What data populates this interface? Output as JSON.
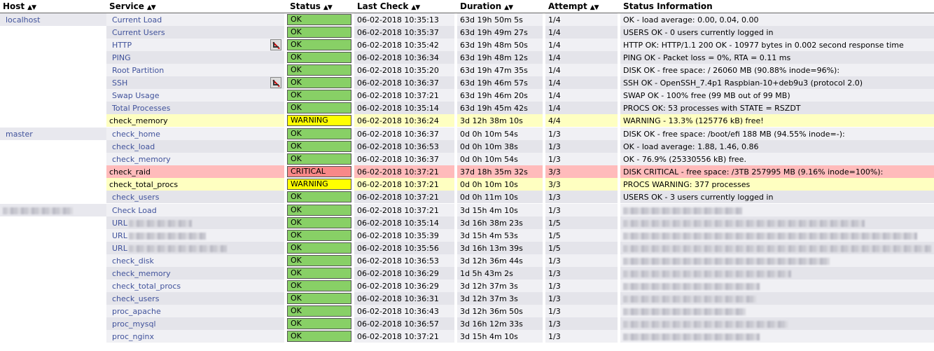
{
  "headers": {
    "host": "Host",
    "service": "Service",
    "status": "Status",
    "last_check": "Last Check",
    "duration": "Duration",
    "attempt": "Attempt",
    "status_info": "Status Information"
  },
  "groups": [
    {
      "host": "localhost",
      "rows": [
        {
          "service": "Current Load",
          "status": "OK",
          "last_check": "06-02-2018 10:35:13",
          "duration": "63d 19h 50m 5s",
          "attempt": "1/4",
          "info": "OK - load average: 0.00, 0.04, 0.00"
        },
        {
          "service": "Current Users",
          "status": "OK",
          "last_check": "06-02-2018 10:35:37",
          "duration": "63d 19h 49m 27s",
          "attempt": "1/4",
          "info": "USERS OK - 0 users currently logged in"
        },
        {
          "service": "HTTP",
          "status": "OK",
          "last_check": "06-02-2018 10:35:42",
          "duration": "63d 19h 48m 50s",
          "attempt": "1/4",
          "info": "HTTP OK: HTTP/1.1 200 OK - 10977 bytes in 0.002 second response time",
          "icon": "notifications-disabled-icon"
        },
        {
          "service": "PING",
          "status": "OK",
          "last_check": "06-02-2018 10:36:34",
          "duration": "63d 19h 48m 12s",
          "attempt": "1/4",
          "info": "PING OK - Packet loss = 0%, RTA = 0.11 ms"
        },
        {
          "service": "Root Partition",
          "status": "OK",
          "last_check": "06-02-2018 10:35:20",
          "duration": "63d 19h 47m 35s",
          "attempt": "1/4",
          "info": "DISK OK - free space: / 26060 MB (90.88% inode=96%):"
        },
        {
          "service": "SSH",
          "status": "OK",
          "last_check": "06-02-2018 10:36:37",
          "duration": "63d 19h 46m 57s",
          "attempt": "1/4",
          "info": "SSH OK - OpenSSH_7.4p1 Raspbian-10+deb9u3 (protocol 2.0)",
          "icon": "notifications-disabled-icon"
        },
        {
          "service": "Swap Usage",
          "status": "OK",
          "last_check": "06-02-2018 10:37:21",
          "duration": "63d 19h 46m 20s",
          "attempt": "1/4",
          "info": "SWAP OK - 100% free (99 MB out of 99 MB)"
        },
        {
          "service": "Total Processes",
          "status": "OK",
          "last_check": "06-02-2018 10:35:14",
          "duration": "63d 19h 45m 42s",
          "attempt": "1/4",
          "info": "PROCS OK: 53 processes with STATE = RSZDT"
        },
        {
          "service": "check_memory",
          "status": "WARNING",
          "last_check": "06-02-2018 10:36:24",
          "duration": "3d 12h 38m 10s",
          "attempt": "4/4",
          "info": "WARNING - 13.3% (125776 kB) free!"
        }
      ]
    },
    {
      "host": "master",
      "rows": [
        {
          "service": "check_home",
          "status": "OK",
          "last_check": "06-02-2018 10:36:37",
          "duration": "0d 0h 10m 54s",
          "attempt": "1/3",
          "info": "DISK OK - free space: /boot/efi 188 MB (94.55% inode=-):"
        },
        {
          "service": "check_load",
          "status": "OK",
          "last_check": "06-02-2018 10:36:53",
          "duration": "0d 0h 10m 38s",
          "attempt": "1/3",
          "info": "OK - load average: 1.88, 1.46, 0.86"
        },
        {
          "service": "check_memory",
          "status": "OK",
          "last_check": "06-02-2018 10:36:37",
          "duration": "0d 0h 10m 54s",
          "attempt": "1/3",
          "info": "OK - 76.9% (25330556 kB) free."
        },
        {
          "service": "check_raid",
          "status": "CRITICAL",
          "last_check": "06-02-2018 10:37:21",
          "duration": "37d 18h 35m 32s",
          "attempt": "3/3",
          "info": "DISK CRITICAL - free space: /3TB 257995 MB (9.16% inode=100%):"
        },
        {
          "service": "check_total_procs",
          "status": "WARNING",
          "last_check": "06-02-2018 10:37:21",
          "duration": "0d 0h 10m 10s",
          "attempt": "3/3",
          "info": "PROCS WARNING: 377 processes"
        },
        {
          "service": "check_users",
          "status": "OK",
          "last_check": "06-02-2018 10:37:21",
          "duration": "0d 0h 11m 10s",
          "attempt": "1/3",
          "info": "USERS OK - 3 users currently logged in"
        }
      ]
    },
    {
      "host": "",
      "rows": [
        {
          "service": "Check Load",
          "status": "OK",
          "last_check": "06-02-2018 10:37:21",
          "duration": "3d 15h 4m 10s",
          "attempt": "1/3",
          "info": ""
        },
        {
          "service": "URL",
          "status": "OK",
          "last_check": "06-02-2018 10:35:14",
          "duration": "3d 16h 38m 23s",
          "attempt": "1/5",
          "info": ""
        },
        {
          "service": "URL",
          "status": "OK",
          "last_check": "06-02-2018 10:35:39",
          "duration": "3d 15h 4m 53s",
          "attempt": "1/5",
          "info": ""
        },
        {
          "service": "URL",
          "status": "OK",
          "last_check": "06-02-2018 10:35:56",
          "duration": "3d 16h 13m 39s",
          "attempt": "1/5",
          "info": ""
        },
        {
          "service": "check_disk",
          "status": "OK",
          "last_check": "06-02-2018 10:36:53",
          "duration": "3d 12h 36m 44s",
          "attempt": "1/3",
          "info": ""
        },
        {
          "service": "check_memory",
          "status": "OK",
          "last_check": "06-02-2018 10:36:29",
          "duration": "1d 5h 43m 2s",
          "attempt": "1/3",
          "info": ""
        },
        {
          "service": "check_total_procs",
          "status": "OK",
          "last_check": "06-02-2018 10:36:29",
          "duration": "3d 12h 37m 3s",
          "attempt": "1/3",
          "info": ""
        },
        {
          "service": "check_users",
          "status": "OK",
          "last_check": "06-02-2018 10:36:31",
          "duration": "3d 12h 37m 3s",
          "attempt": "1/3",
          "info": ""
        },
        {
          "service": "proc_apache",
          "status": "OK",
          "last_check": "06-02-2018 10:36:43",
          "duration": "3d 12h 36m 50s",
          "attempt": "1/3",
          "info": ""
        },
        {
          "service": "proc_mysql",
          "status": "OK",
          "last_check": "06-02-2018 10:36:57",
          "duration": "3d 16h 12m 33s",
          "attempt": "1/3",
          "info": ""
        },
        {
          "service": "proc_nginx",
          "status": "OK",
          "last_check": "06-02-2018 10:37:21",
          "duration": "3d 15h 4m 10s",
          "attempt": "1/3",
          "info": ""
        }
      ]
    }
  ],
  "colors": {
    "ok": "#88d066",
    "warning": "#ffff00",
    "critical": "#f88888",
    "link": "#40529b"
  }
}
